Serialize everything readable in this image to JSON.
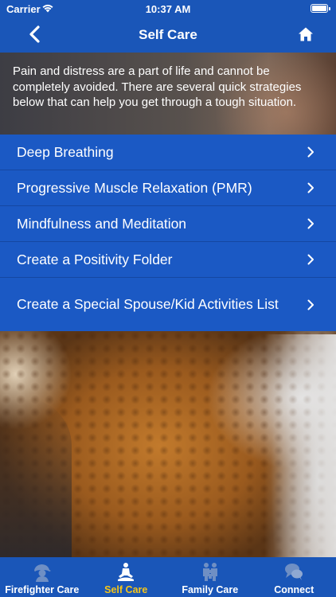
{
  "status_bar": {
    "carrier": "Carrier",
    "time": "10:37 AM"
  },
  "nav": {
    "title": "Self Care",
    "back_icon": "chevron-left-icon",
    "home_icon": "home-icon"
  },
  "intro": {
    "text": "Pain and distress are a part of life and cannot be completely avoided. There are several quick strategies below that can help you get through a tough situation."
  },
  "menu": {
    "items": [
      {
        "label": "Deep Breathing"
      },
      {
        "label": "Progressive Muscle Relaxation (PMR)"
      },
      {
        "label": "Mindfulness and Meditation"
      },
      {
        "label": "Create a Positivity Folder"
      },
      {
        "label": "Create a Special Spouse/Kid Activities List"
      }
    ]
  },
  "tabbar": {
    "tabs": [
      {
        "label": "Firefighter Care",
        "icon": "firefighter-icon"
      },
      {
        "label": "Self Care",
        "icon": "meditation-icon",
        "active": true
      },
      {
        "label": "Family Care",
        "icon": "family-icon"
      },
      {
        "label": "Connect",
        "icon": "chat-bubbles-icon"
      }
    ]
  },
  "colors": {
    "nav_blue": "#1a56b8",
    "menu_blue": "#1b59c4",
    "active_tab": "#f5c518"
  }
}
